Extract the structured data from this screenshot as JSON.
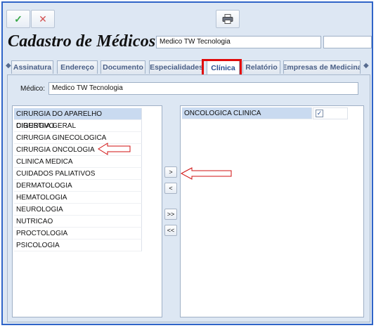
{
  "toolbar": {
    "confirm_icon": "check-icon",
    "cancel_icon": "x-icon",
    "print_icon": "printer-icon"
  },
  "header": {
    "title": "Cadastro de Médicos",
    "name_value": "Medico TW Tecnologia",
    "code_value": ""
  },
  "tabs": [
    {
      "label": "Assinatura"
    },
    {
      "label": "Endereço"
    },
    {
      "label": "Documento"
    },
    {
      "label": "Especialidades"
    },
    {
      "label": "Clínica"
    },
    {
      "label": "Relatório"
    },
    {
      "label": "Empresas de Medicina"
    }
  ],
  "active_tab": "Clínica",
  "form": {
    "medico_label": "Médico:",
    "medico_value": "Medico TW Tecnologia"
  },
  "available_list": [
    "CIRURGIA DO APARELHO DIGESTIVO",
    "CIRURGIA GERAL",
    "CIRURGIA GINECOLOGICA",
    "CIRURGIA ONCOLOGIA",
    "CLINICA MEDICA",
    "CUIDADOS PALIATIVOS",
    "DERMATOLOGIA",
    "HEMATOLOGIA",
    "NEUROLOGIA",
    "NUTRICAO",
    "PROCTOLOGIA",
    "PSICOLOGIA"
  ],
  "selected_list": [
    {
      "label": "ONCOLOGICA CLINICA",
      "checked": true
    }
  ],
  "move_buttons": {
    "add_one": ">",
    "remove_one": "<",
    "add_all": ">>",
    "remove_all": "<<"
  },
  "colors": {
    "frame_border": "#2f64c8",
    "highlight": "#e00a0a",
    "annotation_arrow": "#d01010",
    "selected_row": "#c9daf0"
  }
}
